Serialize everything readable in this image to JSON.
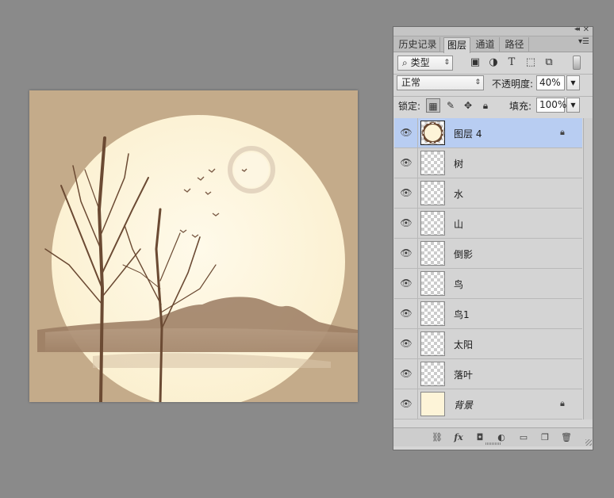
{
  "panel": {
    "tabs": [
      {
        "label": "历史记录",
        "active": false
      },
      {
        "label": "图层",
        "active": true
      },
      {
        "label": "通道",
        "active": false
      },
      {
        "label": "路径",
        "active": false
      }
    ],
    "filter": {
      "label": "类型",
      "icon": "search-icon"
    },
    "filter_icons": [
      "image-filter-icon",
      "adjustment-filter-icon",
      "type-filter-icon",
      "shape-filter-icon",
      "smart-object-filter-icon"
    ],
    "blend_mode": "正常",
    "opacity_label": "不透明度:",
    "opacity_value": "40%",
    "lock_label": "锁定:",
    "lock_icons": [
      "lock-transparent-icon",
      "lock-image-icon",
      "lock-position-icon",
      "lock-all-icon"
    ],
    "fill_label": "填充:",
    "fill_value": "100%",
    "footer_icons": [
      "link-layers-icon",
      "fx-icon",
      "layer-mask-icon",
      "adjustment-layer-icon",
      "group-folder-icon",
      "new-layer-icon",
      "trash-icon"
    ],
    "fx_label": "fx"
  },
  "layers": [
    {
      "name": "图层 4",
      "visible": true,
      "locked": true,
      "selected": true,
      "thumb": "circle"
    },
    {
      "name": "树",
      "visible": true,
      "locked": false,
      "selected": false,
      "thumb": "transparent"
    },
    {
      "name": "水",
      "visible": true,
      "locked": false,
      "selected": false,
      "thumb": "transparent"
    },
    {
      "name": "山",
      "visible": true,
      "locked": false,
      "selected": false,
      "thumb": "transparent"
    },
    {
      "name": "倒影",
      "visible": true,
      "locked": false,
      "selected": false,
      "thumb": "transparent"
    },
    {
      "name": "鸟",
      "visible": true,
      "locked": false,
      "selected": false,
      "thumb": "transparent"
    },
    {
      "name": "鸟1",
      "visible": true,
      "locked": false,
      "selected": false,
      "thumb": "transparent"
    },
    {
      "name": "太阳",
      "visible": true,
      "locked": false,
      "selected": false,
      "thumb": "transparent"
    },
    {
      "name": "落叶",
      "visible": true,
      "locked": false,
      "selected": false,
      "thumb": "transparent"
    },
    {
      "name": "背景",
      "visible": true,
      "locked": true,
      "selected": false,
      "thumb": "plain",
      "italic": true
    }
  ],
  "colors": {
    "canvas_background": "#c4ab8a",
    "moon_fill": "#fdf4d8",
    "tree": "#6b4a33",
    "mountain": "#8a6a52",
    "selection": "#b8cdf2"
  }
}
